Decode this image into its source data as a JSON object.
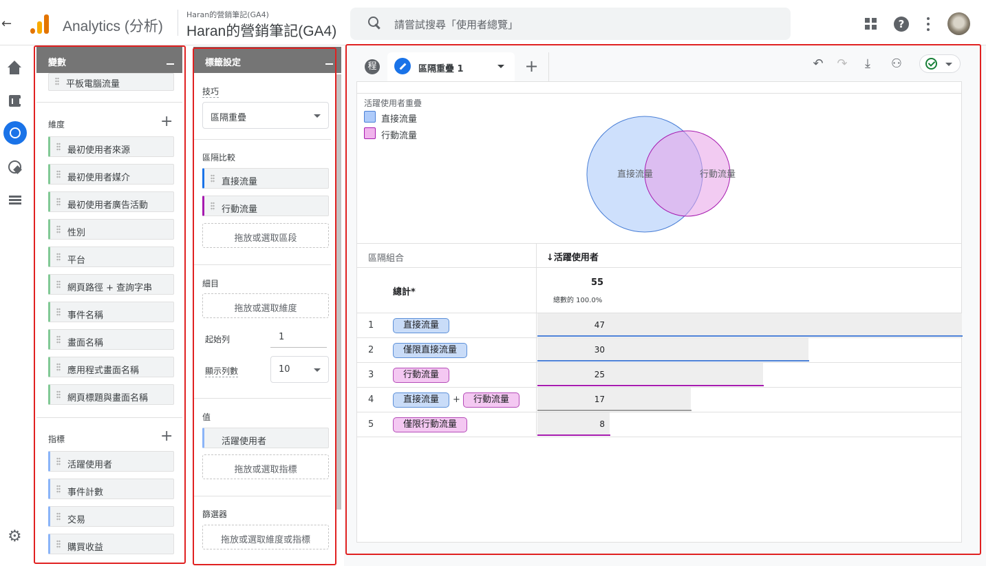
{
  "header": {
    "back_icon": "arrow-left-icon",
    "app_title": "Analytics (分析)",
    "account_small": "Haran的營銷筆記(GA4)",
    "account_big": "Haran的營銷筆記(GA4)",
    "search_placeholder": "請嘗試搜尋「使用者總覽」"
  },
  "variables_panel": {
    "title": "變數",
    "top_chip": "平板電腦流量",
    "dimensions_label": "維度",
    "dimensions": [
      "最初使用者來源",
      "最初使用者媒介",
      "最初使用者廣告活動",
      "性別",
      "平台",
      "網頁路徑 + 查詢字串",
      "事件名稱",
      "畫面名稱",
      "應用程式畫面名稱",
      "網頁標題與畫面名稱"
    ],
    "metrics_label": "指標",
    "metrics": [
      "活躍使用者",
      "事件計數",
      "交易",
      "購買收益"
    ]
  },
  "tab_settings": {
    "title": "標籤設定",
    "technique_label": "技巧",
    "technique_value": "區隔重疊",
    "segment_compare_label": "區隔比較",
    "segments": [
      "直接流量",
      "行動流量"
    ],
    "segment_drop": "拖放或選取區段",
    "breakdown_label": "細目",
    "breakdown_drop": "拖放或選取維度",
    "start_row_label": "起始列",
    "start_row_value": "1",
    "show_rows_label": "顯示列數",
    "show_rows_value": "10",
    "values_label": "值",
    "value_chip": "活躍使用者",
    "values_drop": "拖放或選取指標",
    "filters_label": "篩選器",
    "filters_drop": "拖放或選取維度或指標"
  },
  "canvas": {
    "tab_shape_glyph": "程",
    "tab_name": "區隔重疊 1",
    "venn_title": "活躍使用者重疊",
    "legend": [
      {
        "label": "直接流量",
        "color": "#aecbfa"
      },
      {
        "label": "行動流量",
        "color": "#f0b3ec"
      }
    ],
    "venn_labels": {
      "a": "直接流量",
      "b": "行動流量"
    },
    "table": {
      "col_segment": "區隔組合",
      "col_metric": "↓活躍使用者",
      "total_label": "總計*",
      "total_value": "55",
      "total_pct": "總數的 100.0%",
      "rows": [
        {
          "index": "1",
          "chips": [
            "直接流量"
          ],
          "value": "47"
        },
        {
          "index": "2",
          "chips": [
            "僅限直接流量"
          ],
          "value": "30"
        },
        {
          "index": "3",
          "chips": [
            "行動流量"
          ],
          "value": "25"
        },
        {
          "index": "4",
          "chips": [
            "直接流量",
            "行動流量"
          ],
          "joiner": "+",
          "value": "17"
        },
        {
          "index": "5",
          "chips": [
            "僅限行動流量"
          ],
          "value": "8"
        }
      ]
    }
  },
  "colors": {
    "direct": "#4a7fd6",
    "mobile": "#a61aaf",
    "combined": "#9e9e9e",
    "highlight_frame": "#e02020"
  }
}
